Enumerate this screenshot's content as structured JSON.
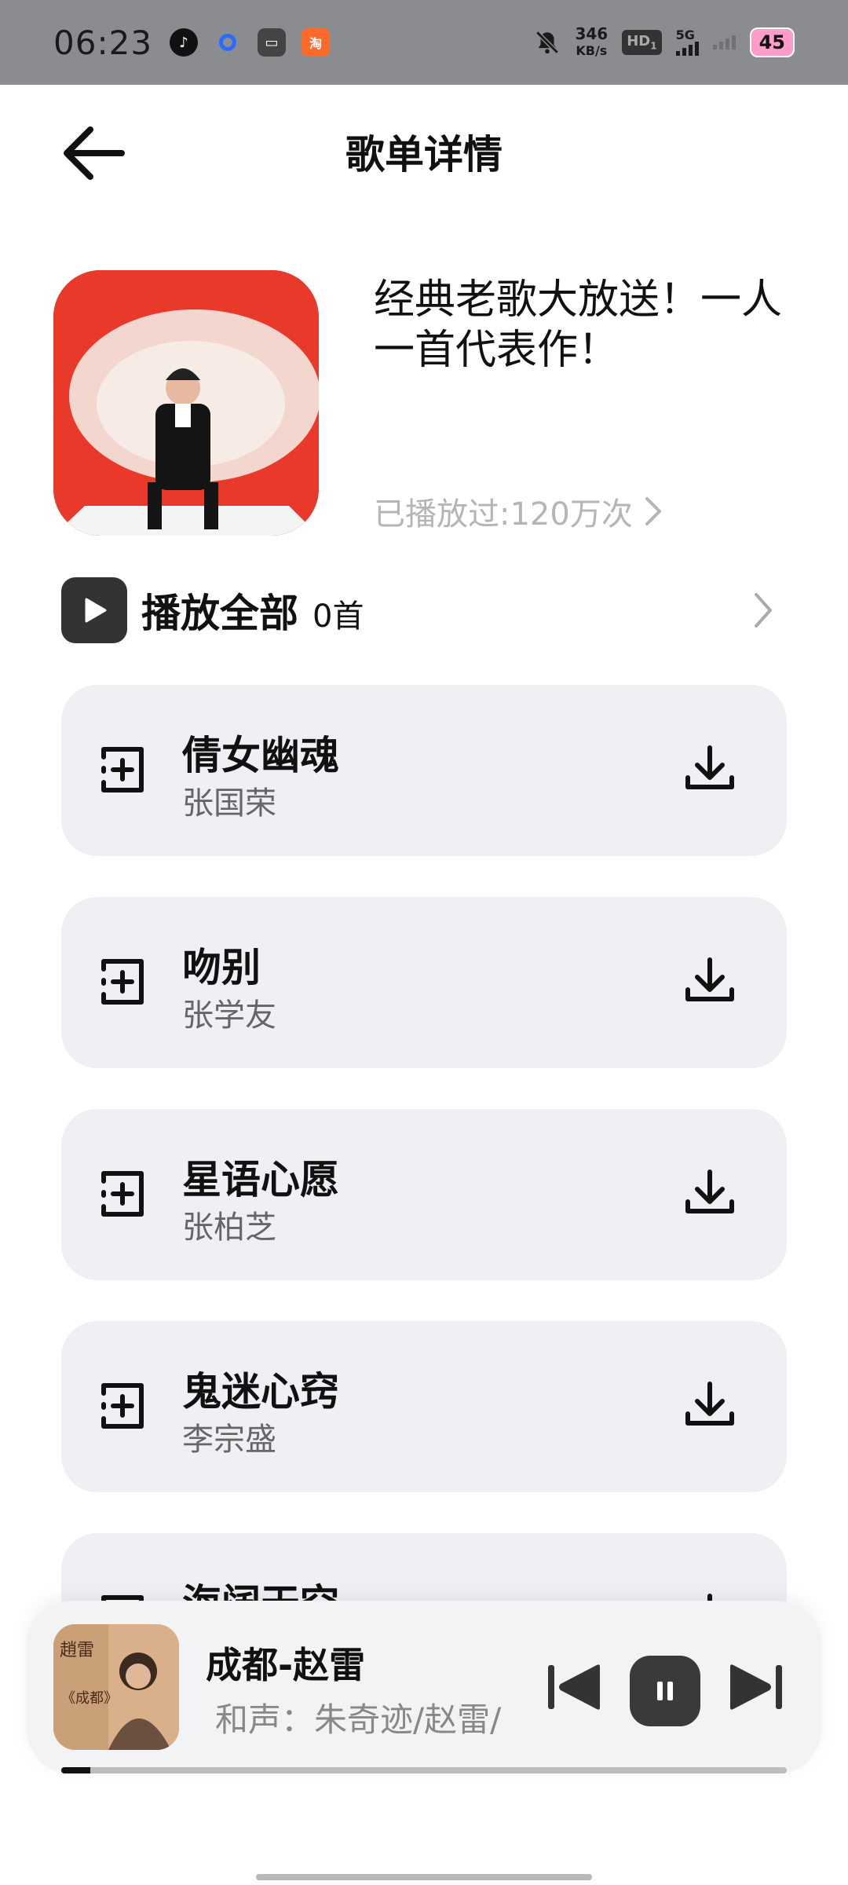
{
  "status_bar": {
    "time": "06:23",
    "net_speed_value": "346",
    "net_speed_unit": "KB/s",
    "hd_label": "HD",
    "hd_sub": "1",
    "network": "5G",
    "battery": "45",
    "app_red_label": "淘"
  },
  "header": {
    "title": "歌单详情"
  },
  "playlist": {
    "title": "经典老歌大放送！一人一首代表作！",
    "plays": "已播放过:120万次"
  },
  "play_all": {
    "label": "播放全部",
    "count": "0首"
  },
  "songs": [
    {
      "name": "倩女幽魂",
      "artist": "张国荣"
    },
    {
      "name": "吻别",
      "artist": "张学友"
    },
    {
      "name": "星语心愿",
      "artist": "张柏芝"
    },
    {
      "name": "鬼迷心窍",
      "artist": "李宗盛"
    },
    {
      "name": "海阔天空",
      "artist": ""
    }
  ],
  "player": {
    "title": "成都-赵雷",
    "subtitle": "和声：朱奇迹/赵雷/",
    "progress": 0.04
  },
  "colors": {
    "status_bar_bg": "#8a8c90",
    "card_bg": "#eff0f4",
    "accent_dark": "#333333",
    "muted_text": "#b5b5b5",
    "cover_red": "#e63a2c",
    "battery_pink": "#ff9cc9"
  }
}
